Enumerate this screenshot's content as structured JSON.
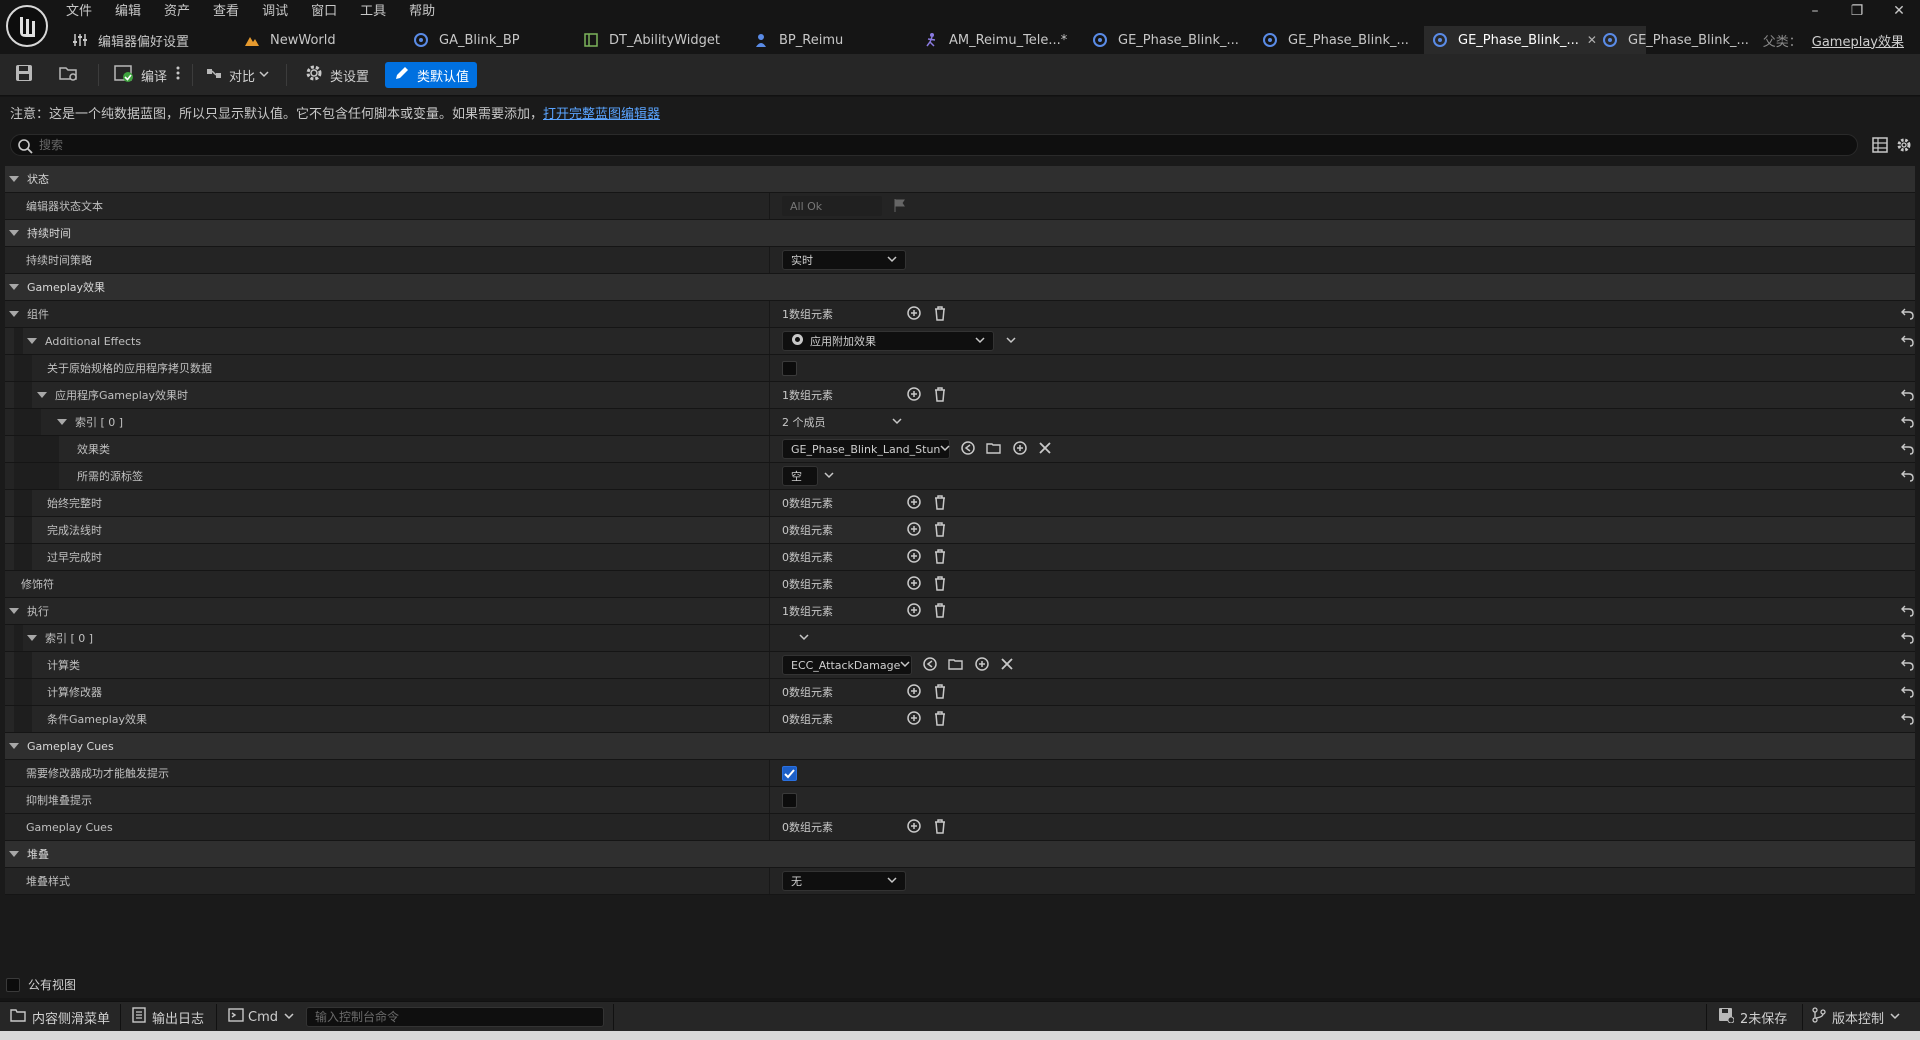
{
  "menu": [
    "文件",
    "编辑",
    "资产",
    "查看",
    "调试",
    "窗口",
    "工具",
    "帮助"
  ],
  "tabs": [
    {
      "label": "编辑器偏好设置",
      "icon": "sliders-icon",
      "color": "#c8c8c8"
    },
    {
      "label": "NewWorld",
      "icon": "level-icon",
      "color": "#e69a2e"
    },
    {
      "label": "GA_Blink_BP",
      "icon": "blueprint-icon",
      "color": "#5a8be6"
    },
    {
      "label": "DT_AbilityWidget",
      "icon": "datatable-icon",
      "color": "#7db35b"
    },
    {
      "label": "BP_Reimu",
      "icon": "character-icon",
      "color": "#5a8be6"
    },
    {
      "label": "AM_Reimu_Tele...*",
      "icon": "montage-icon",
      "color": "#8a7ae0"
    },
    {
      "label": "GE_Phase_Blink_...",
      "icon": "blueprint-icon",
      "color": "#5a8be6"
    },
    {
      "label": "GE_Phase_Blink_...",
      "icon": "blueprint-icon",
      "color": "#5a8be6"
    },
    {
      "label": "GE_Phase_Blink_...",
      "icon": "blueprint-icon",
      "color": "#5a8be6",
      "active": true
    },
    {
      "label": "GE_Phase_Blink_...",
      "icon": "blueprint-icon",
      "color": "#5a8be6"
    }
  ],
  "parent": {
    "prefix": "父类：",
    "name": "Gameplay效果"
  },
  "toolbar": {
    "compile": "编译",
    "diff": "对比",
    "class_settings": "类设置",
    "class_defaults": "类默认值"
  },
  "notice": {
    "text": "注意：这是一个纯数据蓝图，所以只显示默认值。它不包含任何脚本或变量。如果需要添加，",
    "link": "打开完整蓝图编辑器"
  },
  "search": {
    "placeholder": "搜索"
  },
  "rows": {
    "status_cat": "状态",
    "editor_status_text": "编辑器状态文本",
    "editor_status_value": "All Ok",
    "duration_cat": "持续时间",
    "duration_policy": "持续时间策略",
    "duration_policy_value": "实时",
    "ge_cat": "Gameplay效果",
    "components": "组件",
    "components_value": "1数组元素",
    "additional_effects": "Additional Effects",
    "additional_effects_value": "应用附加效果",
    "copy_data": "关于原始规格的应用程序拷贝数据",
    "on_app": "应用程序Gameplay效果时",
    "on_app_value": "1数组元素",
    "index0": "索引 [ 0 ]",
    "index0_value": "2 个成员",
    "effect_class": "效果类",
    "effect_class_value": "GE_Phase_Blink_Land_Stun",
    "required_tags": "所需的源标签",
    "required_tags_value": "空",
    "on_complete_always": "始终完整时",
    "on_complete_always_value": "0数组元素",
    "on_complete_normal": "完成法线时",
    "on_complete_normal_value": "0数组元素",
    "on_complete_premature": "过早完成时",
    "on_complete_premature_value": "0数组元素",
    "modifiers": "修饰符",
    "modifiers_value": "0数组元素",
    "executions": "执行",
    "executions_value": "1数组元素",
    "exec_index0": "索引 [ 0 ]",
    "calc_class": "计算类",
    "calc_class_value": "ECC_AttackDamage",
    "calc_modifiers": "计算修改器",
    "calc_modifiers_value": "0数组元素",
    "conditional_ge": "条件Gameplay效果",
    "conditional_ge_value": "0数组元素",
    "cues_cat": "Gameplay Cues",
    "require_modifier_success": "需要修改器成功才能触发提示",
    "suppress_stacking_cues": "抑制堆叠提示",
    "gameplay_cues": "Gameplay Cues",
    "gameplay_cues_value": "0数组元素",
    "stacking_cat": "堆叠",
    "stacking_type": "堆叠样式",
    "stacking_type_value": "无"
  },
  "public_view": "公有视图",
  "status": {
    "content_drawer": "内容侧滑菜单",
    "output_log": "输出日志",
    "cmd": "Cmd",
    "console_placeholder": "输入控制台命令",
    "unsaved": "2未保存",
    "source_control": "版本控制"
  }
}
